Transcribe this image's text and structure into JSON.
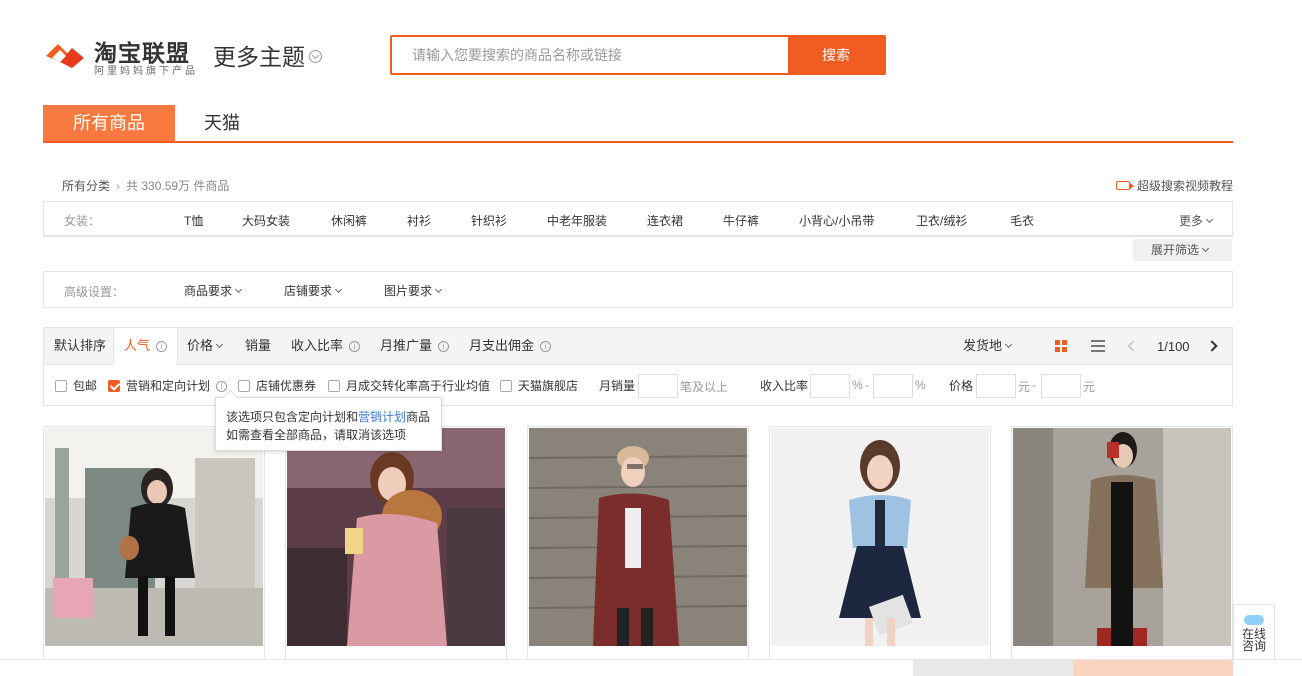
{
  "brand": {
    "name": "淘宝联盟",
    "subtitle": "阿里妈妈旗下产品",
    "accent_color": "#f25b22"
  },
  "theme_selector": {
    "label": "更多主题"
  },
  "search": {
    "placeholder": "请输入您要搜索的商品名称或链接",
    "button_label": "搜索"
  },
  "tabs": [
    {
      "label": "所有商品",
      "active": true
    },
    {
      "label": "天猫",
      "active": false
    }
  ],
  "breadcrumb": {
    "root": "所有分类",
    "count_text": "共 330.59万 件商品"
  },
  "video_tutorial": {
    "label": "超级搜索视频教程",
    "icon": "video-icon"
  },
  "category_filter": {
    "label": "女装：",
    "items": [
      "T恤",
      "大码女装",
      "休闲裤",
      "衬衫",
      "针织衫",
      "中老年服装",
      "连衣裙",
      "牛仔裤",
      "小背心/小吊带",
      "卫衣/绒衫",
      "毛衣"
    ],
    "more_label": "更多",
    "expand_label": "展开筛选"
  },
  "advanced": {
    "label": "高级设置：",
    "items": [
      "商品要求",
      "店铺要求",
      "图片要求"
    ]
  },
  "sort_bar": {
    "items": [
      "默认排序",
      "人气",
      "价格",
      "销量",
      "收入比率",
      "月推广量",
      "月支出佣金"
    ],
    "active": "人气",
    "ship_from": "发货地",
    "page_indicator": "1/100"
  },
  "filters": {
    "free_shipping": {
      "label": "包邮",
      "checked": false
    },
    "marketing_plan": {
      "label": "营销和定向计划",
      "checked": true
    },
    "shop_coupon": {
      "label": "店铺优惠券",
      "checked": false
    },
    "conversion_rate": {
      "label": "月成交转化率高于行业均值",
      "checked": false
    },
    "tmall_flagship": {
      "label": "天猫旗舰店",
      "checked": false
    },
    "monthly_sales_label": "月销量",
    "monthly_sales_suffix": "笔及以上",
    "income_ratio_label": "收入比率",
    "percent": "%",
    "dash": "-",
    "price_label": "价格",
    "yuan": "元"
  },
  "tooltip": {
    "line1_prefix": "该选项只包含定向计划和",
    "line1_link": "营销计划",
    "line1_suffix": "商品",
    "line2": "如需查看全部商品，请取消该选项"
  },
  "products": [
    {
      "image": "woman-black-parka-photo"
    },
    {
      "image": "woman-pink-fur-hood-coat-photo"
    },
    {
      "image": "woman-burgundy-plaid-coat-photo"
    },
    {
      "image": "woman-blue-knit-dress-photo"
    },
    {
      "image": "woman-brown-cardigan-black-jumpsuit-photo"
    }
  ],
  "consult": {
    "line1": "在线",
    "line2": "咨询"
  }
}
